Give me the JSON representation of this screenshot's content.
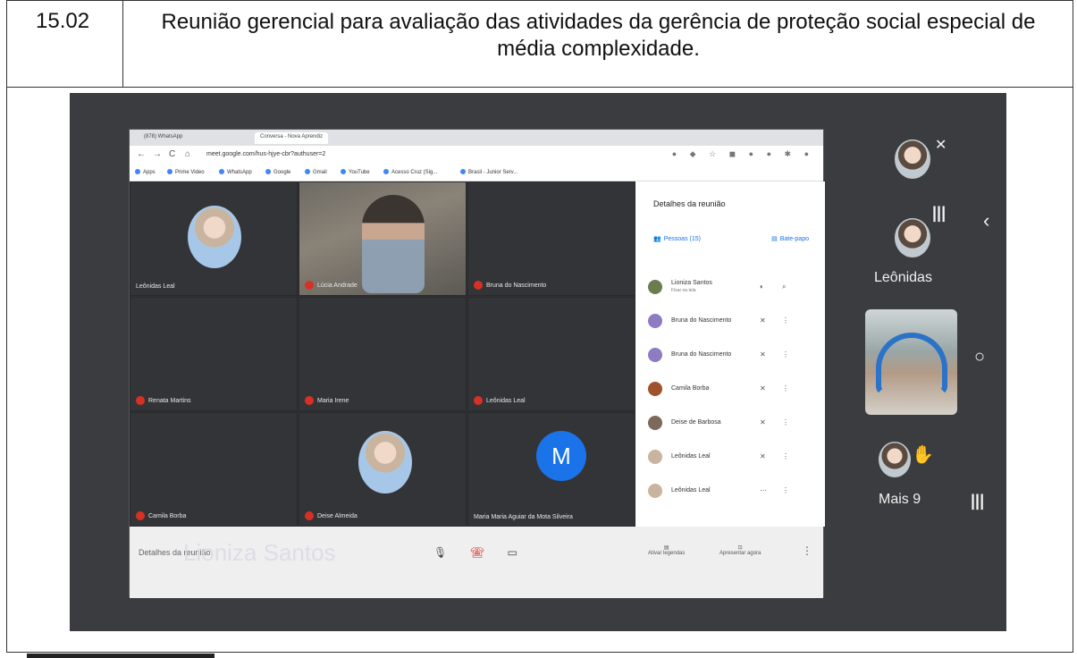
{
  "document": {
    "item_number": "15.02",
    "title": "Reunião gerencial para avaliação das atividades da gerência de proteção social especial de média complexidade."
  },
  "browser": {
    "tabs": [
      "(878) WhatsApp",
      "Conversa - Nova Aprendiz"
    ],
    "url": "meet.google.com/hus-hjye-cbr?authuser=2",
    "bookmarks": [
      "Apps",
      "Prime Video",
      "WhatsApp",
      "Google",
      "Gmail",
      "YouTube",
      "Acesso Cruz (Sig...",
      "Brasil - Junior Serv..."
    ]
  },
  "grid": {
    "tiles": [
      {
        "name": "Leônidas Leal",
        "kind": "photo"
      },
      {
        "name": "Lúcia Andrade",
        "kind": "video"
      },
      {
        "name": "Bruna do Nascimento",
        "kind": "empty"
      },
      {
        "name": "Renata Martins",
        "kind": "empty"
      },
      {
        "name": "Maria Irene",
        "kind": "empty"
      },
      {
        "name": "Leônidas Leal",
        "kind": "empty"
      },
      {
        "name": "Camila Borba",
        "kind": "empty"
      },
      {
        "name": "Deise Almeida",
        "kind": "photo"
      },
      {
        "name": "Maria Maria Aguiar da Mota Silveira",
        "kind": "avatar",
        "initial": "M"
      }
    ]
  },
  "panel": {
    "title": "Detalhes da reunião",
    "tab_people": "Pessoas (15)",
    "tab_chat": "Bate-papo",
    "participants": [
      {
        "name": "Lioniza Santos",
        "sub": "Fixar na tela"
      },
      {
        "name": "Bruna do Nascimento",
        "sub": ""
      },
      {
        "name": "Bruna do Nascimento",
        "sub": ""
      },
      {
        "name": "Camila Borba",
        "sub": ""
      },
      {
        "name": "Deise de Barbosa",
        "sub": ""
      },
      {
        "name": "Leônidas Leal",
        "sub": ""
      },
      {
        "name": "Leônidas Leal",
        "sub": ""
      }
    ]
  },
  "controls": {
    "overlay_name": "Lioniza Santos",
    "overlay_small": "Detalhes da reunião",
    "present_label": "Ativar legendas",
    "share_label": "Apresentar agora"
  },
  "rail": {
    "name_label": "Leônidas",
    "more_label": "Mais 9"
  }
}
